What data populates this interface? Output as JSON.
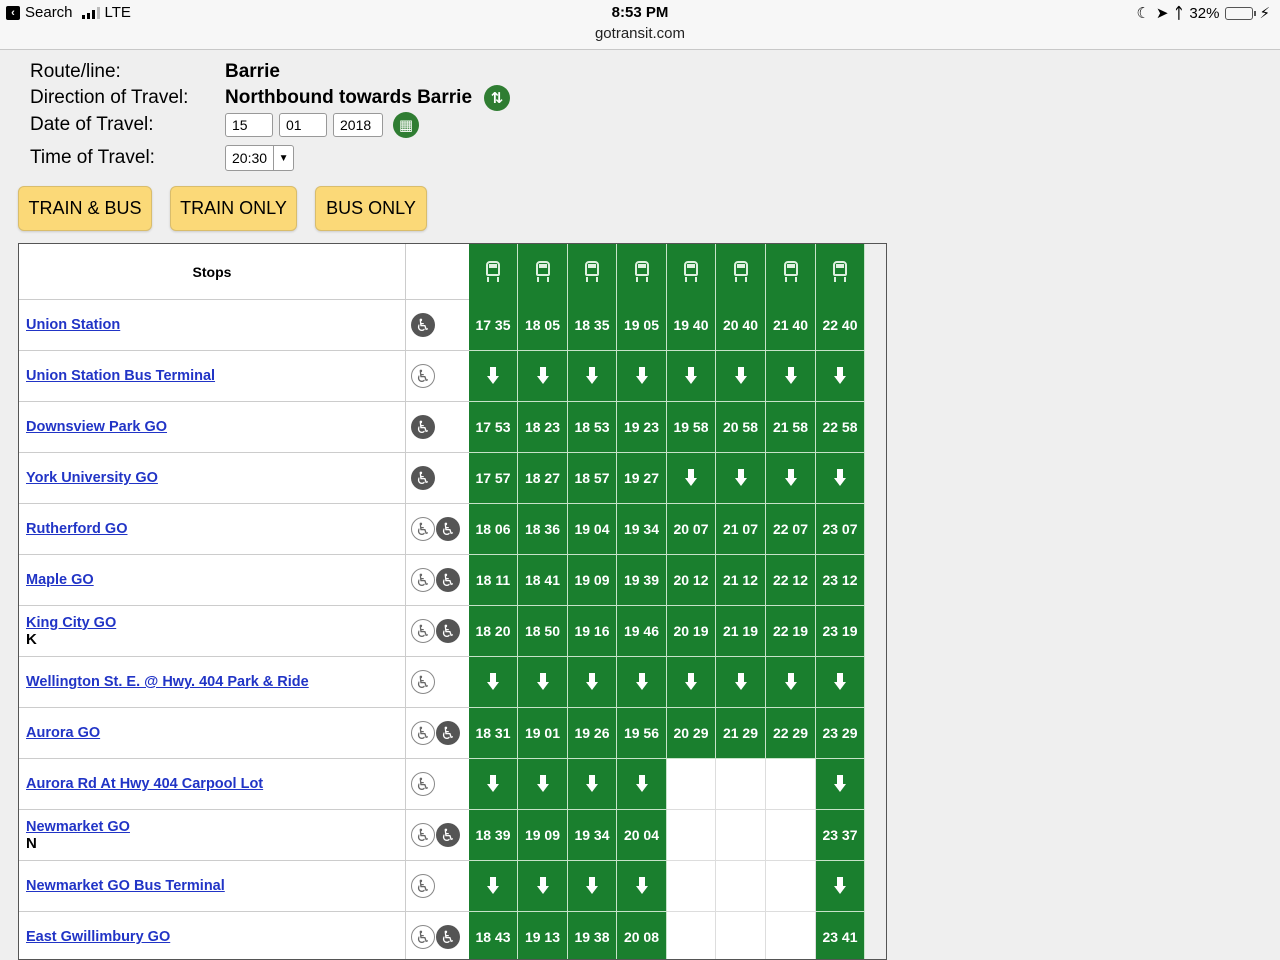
{
  "status_bar": {
    "back_label": "Search",
    "carrier": "LTE",
    "time": "8:53 PM",
    "url": "gotransit.com",
    "battery": "32%",
    "battery_level": 0.32
  },
  "form": {
    "route_label": "Route/line:",
    "route_value": "Barrie",
    "direction_label": "Direction of Travel:",
    "direction_value": "Northbound towards Barrie",
    "date_label": "Date of Travel:",
    "date_day": "15",
    "date_month": "01",
    "date_year": "2018",
    "time_label": "Time of Travel:",
    "time_value": "20:30"
  },
  "filters": {
    "train_bus": "TRAIN & BUS",
    "train_only": "TRAIN ONLY",
    "bus_only": "BUS ONLY"
  },
  "schedule": {
    "stops_header": "Stops",
    "trip_count": 8,
    "rows": [
      {
        "stop": "Union Station",
        "code": "",
        "access": [
          "solid"
        ],
        "times": [
          "17 35",
          "18 05",
          "18 35",
          "19 05",
          "19 40",
          "20 40",
          "21 40",
          "22 40"
        ]
      },
      {
        "stop": "Union Station Bus Terminal",
        "code": "",
        "access": [
          "outline"
        ],
        "times": [
          "↓",
          "↓",
          "↓",
          "↓",
          "↓",
          "↓",
          "↓",
          "↓"
        ]
      },
      {
        "stop": "Downsview Park GO",
        "code": "",
        "access": [
          "solid"
        ],
        "times": [
          "17 53",
          "18 23",
          "18 53",
          "19 23",
          "19 58",
          "20 58",
          "21 58",
          "22 58"
        ]
      },
      {
        "stop": "York University GO",
        "code": "",
        "access": [
          "solid"
        ],
        "times": [
          "17 57",
          "18 27",
          "18 57",
          "19 27",
          "↓",
          "↓",
          "↓",
          "↓"
        ]
      },
      {
        "stop": "Rutherford GO",
        "code": "",
        "access": [
          "outline",
          "solid"
        ],
        "times": [
          "18 06",
          "18 36",
          "19 04",
          "19 34",
          "20 07",
          "21 07",
          "22 07",
          "23 07"
        ]
      },
      {
        "stop": "Maple GO",
        "code": "",
        "access": [
          "outline",
          "solid"
        ],
        "times": [
          "18 11",
          "18 41",
          "19 09",
          "19 39",
          "20 12",
          "21 12",
          "22 12",
          "23 12"
        ]
      },
      {
        "stop": "King City GO",
        "code": "K",
        "access": [
          "outline",
          "solid"
        ],
        "times": [
          "18 20",
          "18 50",
          "19 16",
          "19 46",
          "20 19",
          "21 19",
          "22 19",
          "23 19"
        ]
      },
      {
        "stop": "Wellington St. E. @ Hwy. 404 Park & Ride",
        "code": "",
        "access": [
          "outline"
        ],
        "times": [
          "↓",
          "↓",
          "↓",
          "↓",
          "↓",
          "↓",
          "↓",
          "↓"
        ]
      },
      {
        "stop": "Aurora GO",
        "code": "",
        "access": [
          "outline",
          "solid"
        ],
        "times": [
          "18 31",
          "19 01",
          "19 26",
          "19 56",
          "20 29",
          "21 29",
          "22 29",
          "23 29"
        ]
      },
      {
        "stop": "Aurora Rd At Hwy 404 Carpool Lot",
        "code": "",
        "access": [
          "outline"
        ],
        "times": [
          "↓",
          "↓",
          "↓",
          "↓",
          "",
          "",
          "",
          "↓"
        ]
      },
      {
        "stop": "Newmarket GO",
        "code": "N",
        "access": [
          "outline",
          "solid"
        ],
        "times": [
          "18 39",
          "19 09",
          "19 34",
          "20 04",
          "",
          "",
          "",
          "23 37"
        ]
      },
      {
        "stop": "Newmarket GO Bus Terminal",
        "code": "",
        "access": [
          "outline"
        ],
        "times": [
          "↓",
          "↓",
          "↓",
          "↓",
          "",
          "",
          "",
          "↓"
        ]
      },
      {
        "stop": "East Gwillimbury GO",
        "code": "",
        "access": [
          "outline",
          "solid"
        ],
        "times": [
          "18 43",
          "19 13",
          "19 38",
          "20 08",
          "",
          "",
          "",
          "23 41"
        ]
      }
    ]
  },
  "colors": {
    "green": "#1a7f2e",
    "link": "#2134c6",
    "button": "#fbd978"
  }
}
